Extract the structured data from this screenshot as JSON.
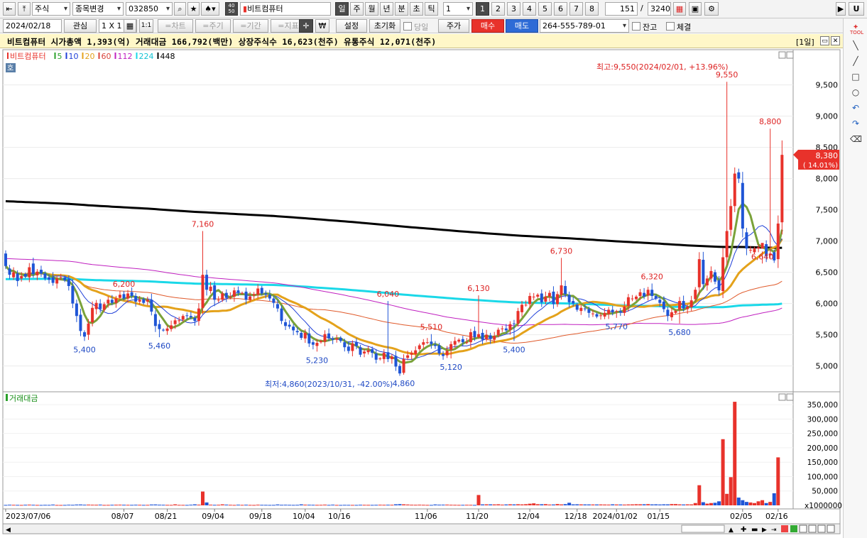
{
  "toolbar1": {
    "nav_first": "⇤",
    "nav_top": "⤒",
    "market": "주식",
    "change_label": "종목변경",
    "code": "032850",
    "search_icon": "search-icon",
    "star_icon": "star-icon",
    "spade_icon": "spade-icon",
    "badge_top": "40",
    "badge_bottom": "50",
    "stock_name": "비트컴퓨터",
    "periods": [
      "일",
      "주",
      "월",
      "년",
      "분",
      "초",
      "틱"
    ],
    "period_value": "1",
    "layouts": [
      "1",
      "2",
      "3",
      "4",
      "5",
      "6",
      "7",
      "8"
    ],
    "count": "151",
    "slash": "/",
    "total": "3240",
    "right_u": "U",
    "right_mark": "▶"
  },
  "toolbar2": {
    "date": "2024/02/18",
    "watch": "관심",
    "grid": "1 X 1",
    "btn_1_1": "1:1",
    "chart": "=차트",
    "cycle": "=주기",
    "period": "=기간",
    "indicator": "=지표",
    "won": "₩",
    "settings": "설정",
    "reset": "초기화",
    "today": "당일",
    "price": "주가",
    "buy": "매수",
    "sell": "매도",
    "account": "264-555-789-01",
    "balance": "잔고",
    "fills": "체결"
  },
  "info": {
    "text": "비트컴퓨터  시가총액 1,393(억)  거래대금 166,792(백만)  상장주식수 16,623(천주)  유통주식 12,071(천주)",
    "period_tag": "[1일]"
  },
  "chart_data": {
    "type": "candlestick",
    "legend": [
      {
        "label": "비트컴퓨터",
        "color": "#e8322b"
      },
      {
        "label": "5",
        "color": "#2aa02a"
      },
      {
        "label": "10",
        "color": "#1f3fd8"
      },
      {
        "label": "20",
        "color": "#e4a21b"
      },
      {
        "label": "60",
        "color": "#d9433b"
      },
      {
        "label": "112",
        "color": "#c020c0"
      },
      {
        "label": "224",
        "color": "#1ad8e8"
      },
      {
        "label": "448",
        "color": "#000000"
      }
    ],
    "hoga_tag": "호",
    "price_ticks": [
      "9,500",
      "9,000",
      "8,500",
      "8,000",
      "7,500",
      "7,000",
      "6,500",
      "6,000",
      "5,500",
      "5,000"
    ],
    "price_tick_values": [
      9500,
      9000,
      8500,
      8000,
      7500,
      7000,
      6500,
      6000,
      5500,
      5000
    ],
    "price_range": [
      4700,
      9950
    ],
    "high_note": "최고:9,550(2024/02/01, +13.96%)",
    "low_note": "최저:4,860(2023/10/31, -42.00%)",
    "current_price": "8,380",
    "current_pct": "( 14.01%)",
    "annotations": [
      {
        "label": "7,160",
        "value": 7160,
        "i": 50,
        "kind": "high"
      },
      {
        "label": "6,200",
        "value": 6200,
        "i": 30,
        "kind": "high"
      },
      {
        "label": "6,040",
        "value": 6040,
        "i": 97,
        "kind": "high"
      },
      {
        "label": "6,130",
        "value": 6130,
        "i": 120,
        "kind": "high"
      },
      {
        "label": "5,510",
        "value": 5510,
        "i": 108,
        "kind": "high"
      },
      {
        "label": "6,730",
        "value": 6730,
        "i": 141,
        "kind": "high"
      },
      {
        "label": "6,320",
        "value": 6320,
        "i": 164,
        "kind": "high"
      },
      {
        "label": "9,550",
        "value": 9550,
        "i": 183,
        "kind": "high"
      },
      {
        "label": "8,800",
        "value": 8800,
        "i": 194,
        "kind": "high"
      },
      {
        "label": "6,640",
        "value": 6640,
        "i": 192,
        "kind": "high"
      },
      {
        "label": "5,400",
        "value": 5400,
        "i": 20,
        "kind": "low"
      },
      {
        "label": "5,460",
        "value": 5460,
        "i": 39,
        "kind": "low"
      },
      {
        "label": "5,230",
        "value": 5230,
        "i": 79,
        "kind": "low"
      },
      {
        "label": "4,860",
        "value": 4860,
        "i": 101,
        "kind": "low"
      },
      {
        "label": "5,120",
        "value": 5120,
        "i": 113,
        "kind": "low"
      },
      {
        "label": "5,400",
        "value": 5400,
        "i": 129,
        "kind": "low"
      },
      {
        "label": "5,770",
        "value": 5770,
        "i": 155,
        "kind": "low"
      },
      {
        "label": "5,680",
        "value": 5680,
        "i": 171,
        "kind": "low"
      }
    ],
    "volume_title": "거래대금",
    "volume_ticks": [
      "350,000",
      "300,000",
      "250,000",
      "200,000",
      "150,000",
      "100,000",
      "50,000"
    ],
    "volume_tick_values": [
      350000,
      300000,
      250000,
      200000,
      150000,
      100000,
      50000
    ],
    "volume_unit": "x1000000",
    "volume_range": [
      0,
      375000
    ],
    "x_labels": [
      {
        "label": "2023/07/06",
        "i": 0
      },
      {
        "label": "08/07",
        "i": 30
      },
      {
        "label": "08/21",
        "i": 41
      },
      {
        "label": "09/04",
        "i": 53
      },
      {
        "label": "09/18",
        "i": 65
      },
      {
        "label": "10/04",
        "i": 76
      },
      {
        "label": "10/16",
        "i": 85
      },
      {
        "label": "11/06",
        "i": 107
      },
      {
        "label": "11/20",
        "i": 120
      },
      {
        "label": "12/04",
        "i": 133
      },
      {
        "label": "12/18",
        "i": 145
      },
      {
        "label": "2024/01/02",
        "i": 155
      },
      {
        "label": "01/15",
        "i": 166
      },
      {
        "label": "02/05",
        "i": 187
      },
      {
        "label": "02/16",
        "i": 196
      }
    ],
    "close_series": [
      6600,
      6460,
      6500,
      6360,
      6440,
      6430,
      6580,
      6470,
      6510,
      6480,
      6400,
      6380,
      6330,
      6400,
      6420,
      6370,
      6280,
      6000,
      5800,
      5560,
      5470,
      5680,
      5930,
      6010,
      5910,
      5990,
      6060,
      6010,
      6080,
      6140,
      6080,
      6160,
      6120,
      6030,
      6060,
      6010,
      6060,
      5870,
      5640,
      5590,
      5570,
      5600,
      5650,
      5730,
      5730,
      5800,
      5800,
      5780,
      5720,
      5920,
      6460,
      6220,
      6270,
      6060,
      6060,
      6160,
      6090,
      6110,
      6210,
      6170,
      6170,
      6060,
      6110,
      6150,
      6240,
      6160,
      6140,
      6080,
      6010,
      5920,
      5720,
      5640,
      5630,
      5570,
      5540,
      5450,
      5530,
      5360,
      5340,
      5370,
      5400,
      5510,
      5440,
      5420,
      5440,
      5400,
      5300,
      5240,
      5360,
      5320,
      5180,
      5230,
      5250,
      5210,
      5100,
      5120,
      5210,
      5110,
      5150,
      4990,
      4880,
      5110,
      5170,
      5210,
      5250,
      5330,
      5380,
      5380,
      5350,
      5320,
      5200,
      5160,
      5240,
      5350,
      5400,
      5420,
      5380,
      5380,
      5540,
      5460,
      5510,
      5420,
      5500,
      5430,
      5480,
      5580,
      5600,
      5570,
      5670,
      5670,
      5880,
      5980,
      5980,
      6120,
      6110,
      6140,
      6020,
      6110,
      6170,
      5990,
      6150,
      6290,
      6150,
      6020,
      6000,
      5900,
      5930,
      5910,
      5850,
      5840,
      5790,
      5810,
      5850,
      5900,
      5860,
      5880,
      5860,
      5950,
      6100,
      6080,
      6110,
      6180,
      6110,
      6220,
      6120,
      6080,
      6010,
      5910,
      5800,
      5860,
      5880,
      6040,
      5920,
      5950,
      6050,
      6220,
      6710,
      6310,
      6400,
      6520,
      6350,
      6210,
      6740,
      7160,
      7560,
      8080,
      8000,
      7200,
      6880,
      6860,
      6880,
      6900,
      6970,
      6760,
      6800,
      6690,
      7280,
      8380
    ],
    "open_series": [
      6800,
      6560,
      6420,
      6480,
      6400,
      6470,
      6420,
      6640,
      6450,
      6540,
      6480,
      6420,
      6420,
      6320,
      6420,
      6420,
      6390,
      6280,
      6000,
      5820,
      5540,
      5500,
      5700,
      5910,
      6000,
      5900,
      6000,
      6060,
      6010,
      6090,
      6150,
      6080,
      6180,
      6120,
      6030,
      6070,
      6030,
      6060,
      5830,
      5670,
      5580,
      5560,
      5590,
      5670,
      5720,
      5740,
      5810,
      5800,
      5770,
      5720,
      5930,
      6460,
      6200,
      6290,
      6060,
      6060,
      6170,
      6100,
      6110,
      6210,
      6160,
      6190,
      6060,
      6130,
      6140,
      6250,
      6160,
      6140,
      6080,
      5990,
      5920,
      5700,
      5660,
      5630,
      5560,
      5530,
      5440,
      5520,
      5380,
      5320,
      5380,
      5390,
      5520,
      5440,
      5420,
      5450,
      5380,
      5310,
      5240,
      5380,
      5300,
      5200,
      5220,
      5270,
      5200,
      5110,
      5110,
      5220,
      5110,
      5160,
      5000,
      4890,
      5130,
      5180,
      5190,
      5270,
      5340,
      5380,
      5390,
      5340,
      5330,
      5190,
      5170,
      5260,
      5340,
      5390,
      5430,
      5380,
      5380,
      5560,
      5460,
      5530,
      5430,
      5490,
      5420,
      5490,
      5600,
      5600,
      5580,
      5680,
      5680,
      5860,
      5980,
      5990,
      6100,
      6110,
      6160,
      6030,
      6110,
      6190,
      5990,
      6140,
      6280,
      6140,
      6040,
      5980,
      5880,
      5920,
      5910,
      5830,
      5830,
      5800,
      5790,
      5830,
      5900,
      5880,
      5880,
      5850,
      5960,
      6080,
      6070,
      6120,
      6170,
      6130,
      6220,
      6120,
      6060,
      6030,
      5900,
      5780,
      5850,
      5900,
      6040,
      5910,
      5940,
      6070,
      6260,
      6700,
      6290,
      6400,
      6500,
      6370,
      6200,
      6740,
      7180,
      7560,
      8100,
      7930,
      7140,
      6850,
      6820,
      6880,
      6880,
      6950,
      6770,
      6820,
      6710,
      7300
    ],
    "volume_series": [
      1500,
      2100,
      1800,
      1600,
      1400,
      2000,
      2400,
      1900,
      1500,
      1400,
      1700,
      1600,
      2600,
      1400,
      1300,
      1500,
      2100,
      1800,
      2700,
      2900,
      2200,
      2500,
      2100,
      2000,
      2400,
      1500,
      1600,
      1900,
      2100,
      2300,
      2000,
      1800,
      1700,
      2100,
      1900,
      1600,
      1700,
      2800,
      3000,
      2200,
      2000,
      1700,
      1600,
      3400,
      1700,
      1600,
      1500,
      2200,
      3400,
      2400,
      48000,
      10100,
      2300,
      1800,
      2000,
      3400,
      2500,
      1900,
      1500,
      2200,
      1700,
      2100,
      1600,
      1400,
      2200,
      1800,
      1700,
      1500,
      1600,
      3000,
      1900,
      2100,
      1800,
      1600,
      1800,
      3400,
      2300,
      2100,
      1900,
      1700,
      1800,
      2400,
      1600,
      2300,
      1500,
      1400,
      1700,
      1600,
      1500,
      1500,
      2000,
      1800,
      1700,
      1600,
      1800,
      2100,
      1900,
      2100,
      2000,
      3600,
      4200,
      3500,
      2800,
      2100,
      1900,
      2200,
      1900,
      1600,
      1500,
      3000,
      2300,
      2400,
      2500,
      2000,
      1800,
      1600,
      1700,
      1900,
      1800,
      1500,
      36000,
      3300,
      3500,
      3400,
      3200,
      3600,
      2500,
      3100,
      3600,
      3300,
      3800,
      3300,
      4000,
      5700,
      7000,
      4000,
      3800,
      4200,
      2800,
      3000,
      4500,
      3200,
      4200,
      9000,
      3400,
      3600,
      3300,
      3200,
      3100,
      3000,
      3000,
      3100,
      2800,
      2600,
      3500,
      3000,
      2900,
      2600,
      3100,
      3300,
      3800,
      3600,
      3700,
      4200,
      3300,
      3500,
      3000,
      3500,
      3400,
      4400,
      4400,
      3400,
      3000,
      3400,
      3300,
      8000,
      70000,
      11000,
      6000,
      8000,
      9000,
      14000,
      230000,
      40000,
      98000,
      360000,
      27000,
      18000,
      12000,
      10000,
      8000,
      14000,
      18000,
      8000,
      12000,
      42000,
      166792
    ]
  }
}
